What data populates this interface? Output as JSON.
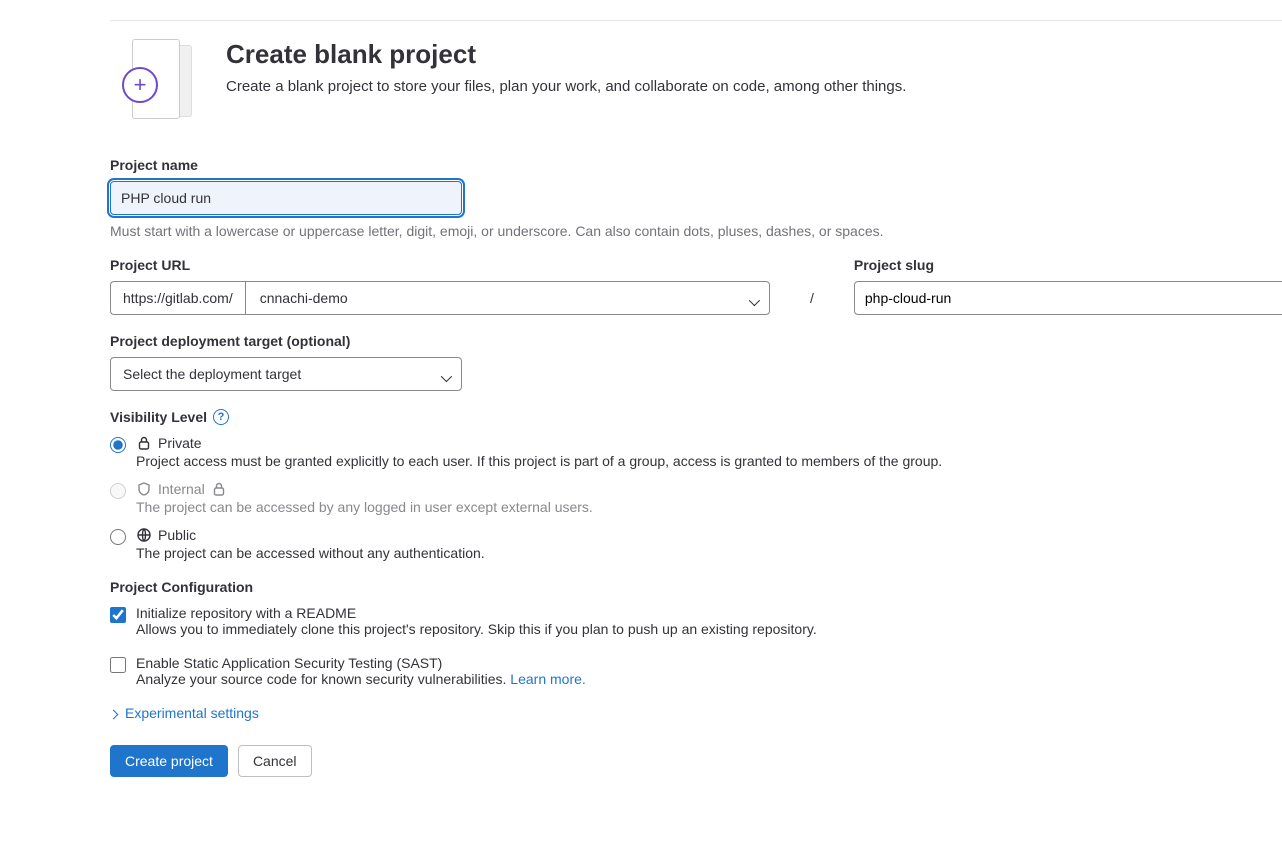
{
  "header": {
    "title": "Create blank project",
    "subtitle": "Create a blank project to store your files, plan your work, and collaborate on code, among other things."
  },
  "project_name": {
    "label": "Project name",
    "value": "PHP cloud run",
    "helper": "Must start with a lowercase or uppercase letter, digit, emoji, or underscore. Can also contain dots, pluses, dashes, or spaces."
  },
  "project_url": {
    "label": "Project URL",
    "prefix": "https://gitlab.com/",
    "namespace": "cnnachi-demo"
  },
  "slash": "/",
  "project_slug": {
    "label": "Project slug",
    "value": "php-cloud-run"
  },
  "deployment": {
    "label": "Project deployment target (optional)",
    "placeholder": "Select the deployment target"
  },
  "visibility": {
    "heading": "Visibility Level",
    "options": {
      "private": {
        "label": "Private",
        "desc": "Project access must be granted explicitly to each user. If this project is part of a group, access is granted to members of the group."
      },
      "internal": {
        "label": "Internal",
        "desc": "The project can be accessed by any logged in user except external users."
      },
      "public": {
        "label": "Public",
        "desc": "The project can be accessed without any authentication."
      }
    }
  },
  "config": {
    "heading": "Project Configuration",
    "readme": {
      "label": "Initialize repository with a README",
      "desc": "Allows you to immediately clone this project's repository. Skip this if you plan to push up an existing repository."
    },
    "sast": {
      "label": "Enable Static Application Security Testing (SAST)",
      "desc_prefix": "Analyze your source code for known security vulnerabilities. ",
      "learn_more": "Learn more."
    }
  },
  "experimental": "Experimental settings",
  "buttons": {
    "create": "Create project",
    "cancel": "Cancel"
  }
}
